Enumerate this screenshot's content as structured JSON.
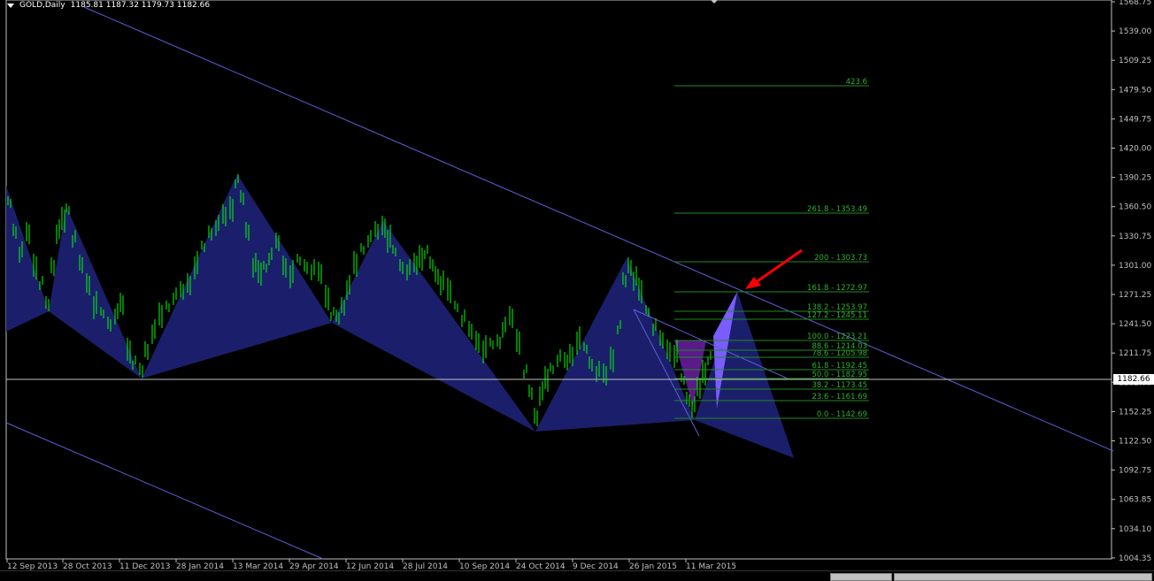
{
  "header": {
    "symbol": "GOLD,Daily",
    "ohlc": "1185.81 1187.32 1179.73 1182.66"
  },
  "price_axis": {
    "current_price": "1182.66",
    "labels": [
      "1568.75",
      "1539.00",
      "1509.25",
      "1479.50",
      "1449.75",
      "1420.00",
      "1390.25",
      "1360.50",
      "1330.75",
      "1301.00",
      "1271.25",
      "1241.50",
      "1211.75",
      "1182.00",
      "1152.25",
      "1122.50",
      "1092.75",
      "1063.85",
      "1034.10",
      "1004.35"
    ]
  },
  "time_axis": {
    "labels": [
      "12 Sep 2013",
      "28 Oct 2013",
      "11 Dec 2013",
      "28 Jan 2014",
      "13 Mar 2014",
      "29 Apr 2014",
      "12 Jun 2014",
      "28 Jul 2014",
      "10 Sep 2014",
      "24 Oct 2014",
      "9 Dec 2014",
      "26 Jan 2015",
      "11 Mar 2015"
    ]
  },
  "fibonacci_levels": [
    {
      "label": "423.6"
    },
    {
      "label": "261.8 - 1353.49"
    },
    {
      "label": "200 - 1303.73"
    },
    {
      "label": "161.8 - 1272.97"
    },
    {
      "label": "138.2 - 1253.97"
    },
    {
      "label": "127.2 - 1245.11"
    },
    {
      "label": "100.0 - 1223.21"
    },
    {
      "label": "88.6 - 1214.03"
    },
    {
      "label": "78.6 - 1205.98"
    },
    {
      "label": "61.8 - 1192.45"
    },
    {
      "label": "50.0 - 1182.95"
    },
    {
      "label": "38.2 - 1173.45"
    },
    {
      "label": "23.6 - 1161.69"
    },
    {
      "label": "0.0 - 1142.69"
    }
  ],
  "colors": {
    "background": "#000000",
    "candles": "#00ff00",
    "harmonic_fill": "#1b1f6b",
    "trendline": "#5a5fd6",
    "fib": "#1f8a1f",
    "fib_text": "#2fae2f",
    "arrow": "#ff0000",
    "crpattern1": "#5a1a8a",
    "crpattern2": "#7b5cff",
    "axis": "#c0c0c0"
  }
}
